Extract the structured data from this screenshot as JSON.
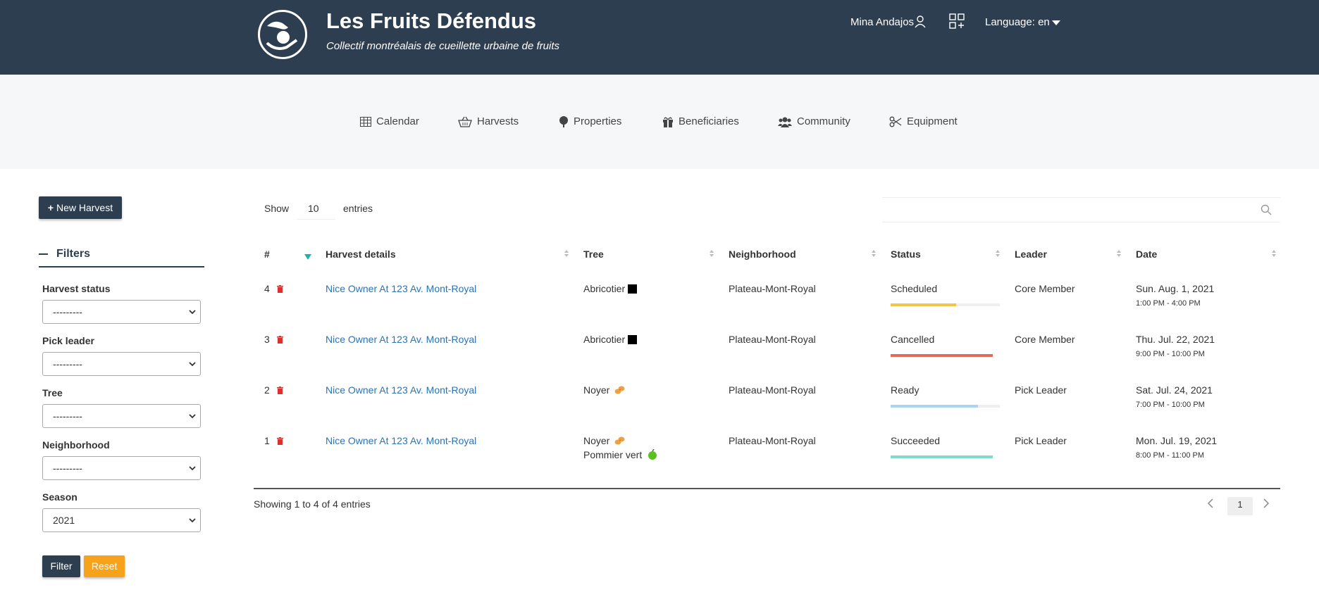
{
  "header": {
    "title": "Les Fruits Défendus",
    "subtitle": "Collectif montréalais de cueillette urbaine de fruits",
    "user_name": "Mina Andajos",
    "language_label": "Language: en"
  },
  "nav": {
    "calendar": "Calendar",
    "harvests": "Harvests",
    "properties": "Properties",
    "beneficiaries": "Beneficiaries",
    "community": "Community",
    "equipment": "Equipment"
  },
  "sidebar": {
    "new_harvest": "New Harvest",
    "filters_title": "Filters",
    "fields": [
      {
        "label": "Harvest status",
        "value": "---------"
      },
      {
        "label": "Pick leader",
        "value": "---------"
      },
      {
        "label": "Tree",
        "value": "---------"
      },
      {
        "label": "Neighborhood",
        "value": "---------"
      },
      {
        "label": "Season",
        "value": "2021"
      }
    ],
    "filter_button": "Filter",
    "reset_button": "Reset"
  },
  "table": {
    "show_label": "Show",
    "page_size": "10",
    "entries_label": "entries",
    "search_value": "",
    "columns": {
      "num": "#",
      "details": "Harvest details",
      "tree": "Tree",
      "neighborhood": "Neighborhood",
      "status": "Status",
      "leader": "Leader",
      "date": "Date"
    },
    "rows": [
      {
        "num": "4",
        "details": "Nice Owner At 123 Av. Mont-Royal",
        "tree": "Abricotier",
        "tree2": "",
        "neighborhood": "Plateau-Mont-Royal",
        "status": "Scheduled",
        "status_color": "#f0c64a",
        "progress": 0.6,
        "leader": "Core Member",
        "date": "Sun. Aug. 1, 2021",
        "time": "1:00 PM - 4:00 PM"
      },
      {
        "num": "3",
        "details": "Nice Owner At 123 Av. Mont-Royal",
        "tree": "Abricotier",
        "tree2": "",
        "neighborhood": "Plateau-Mont-Royal",
        "status": "Cancelled",
        "status_color": "#e06a5a",
        "progress": 1.0,
        "leader": "Core Member",
        "date": "Thu. Jul. 22, 2021",
        "time": "9:00 PM - 10:00 PM"
      },
      {
        "num": "2",
        "details": "Nice Owner At 123 Av. Mont-Royal",
        "tree": "Noyer",
        "tree2": "",
        "neighborhood": "Plateau-Mont-Royal",
        "status": "Ready",
        "status_color": "#a8d4f0",
        "progress": 0.8,
        "leader": "Pick Leader",
        "date": "Sat. Jul. 24, 2021",
        "time": "7:00 PM - 10:00 PM"
      },
      {
        "num": "1",
        "details": "Nice Owner At 123 Av. Mont-Royal",
        "tree": "Noyer",
        "tree2": "Pommier vert",
        "neighborhood": "Plateau-Mont-Royal",
        "status": "Succeeded",
        "status_color": "#7fdcc6",
        "progress": 1.0,
        "leader": "Pick Leader",
        "date": "Mon. Jul. 19, 2021",
        "time": "8:00 PM - 11:00 PM"
      }
    ],
    "info": "Showing 1 to 4 of 4 entries",
    "current_page": "1"
  },
  "colors": {
    "header_bg": "#2d3e50",
    "link": "#2a73b8",
    "reset_btn": "#f6a21a",
    "trash": "#d9312e"
  }
}
